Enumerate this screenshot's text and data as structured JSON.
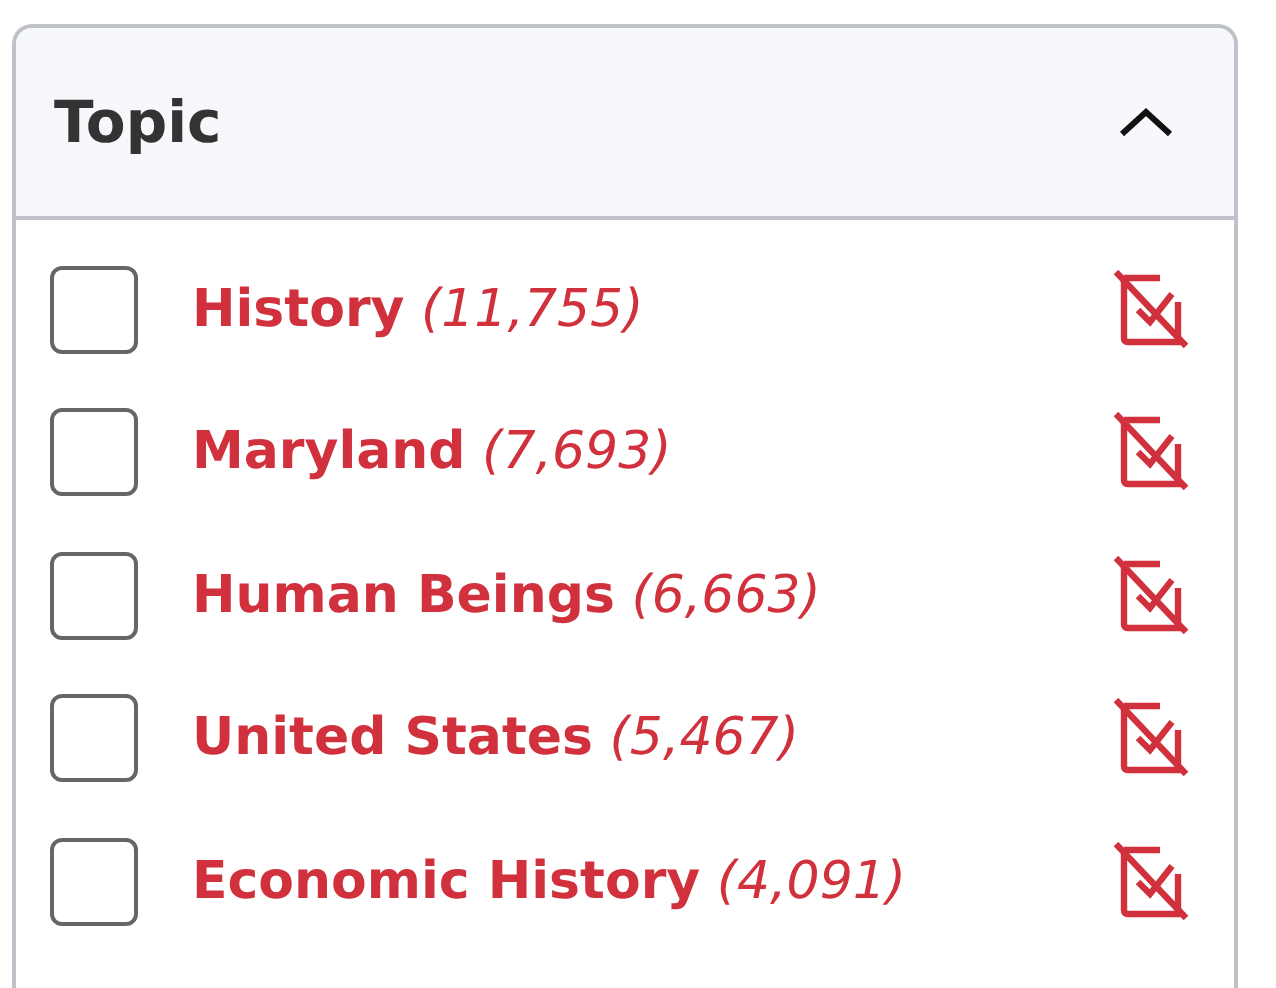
{
  "facet": {
    "title": "Topic",
    "expanded": true,
    "items": [
      {
        "label": "History",
        "count": "(11,755)",
        "checked": false
      },
      {
        "label": "Maryland",
        "count": "(7,693)",
        "checked": false
      },
      {
        "label": "Human Beings",
        "count": "(6,663)",
        "checked": false
      },
      {
        "label": "United States",
        "count": "(5,467)",
        "checked": false
      },
      {
        "label": "Economic History",
        "count": "(4,091)",
        "checked": false
      }
    ]
  }
}
